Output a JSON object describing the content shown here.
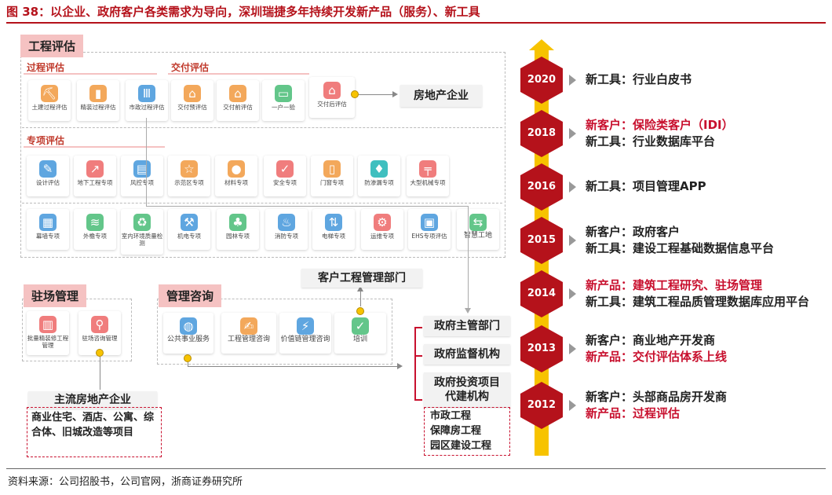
{
  "title": "图 38：以企业、政府客户各类需求为导向，深圳瑞捷多年持续开发新产品（服务）、新工具",
  "source": "资料来源：公司招股书，公司官网，浙商证券研究所",
  "engineering": {
    "header": "工程评估",
    "process_label": "过程评估",
    "delivery_label": "交付评估",
    "special_label": "专项评估",
    "process_items": [
      "土建过程评估",
      "精装过程评估",
      "市政过程评估"
    ],
    "delivery_items": [
      "交付预评估",
      "交付前评估",
      "一户一验",
      "交付后评估"
    ],
    "special_row1": [
      "设计评估",
      "地下工程专项",
      "风控专项",
      "示范区专项",
      "材料专项",
      "安全专项",
      "门窗专项",
      "防渗漏专项",
      "大型机械专项"
    ],
    "special_row2": [
      "幕墙专项",
      "外檐专项",
      "室内环境质量检测",
      "机电专项",
      "园林专项",
      "消防专项",
      "电梯专项",
      "运维专项",
      "EHS专项评估",
      "智慧工地"
    ],
    "target": "房地产企业"
  },
  "onsite": {
    "header": "驻场管理",
    "items": [
      "批量精装修工程管理",
      "驻场咨询管理"
    ],
    "target": "主流房地产企业",
    "target_desc": "商业住宅、酒店、公寓、综合体、旧城改造等项目"
  },
  "consulting": {
    "header": "管理咨询",
    "items": [
      "公共事业服务",
      "工程管理咨询",
      "价值链管理咨询",
      "培训"
    ],
    "client_box": "客户工程管理部门"
  },
  "government": {
    "boxes": [
      "政府主管部门",
      "政府监督机构",
      "政府投资项目代建机构"
    ],
    "projects": [
      "市政工程",
      "保障房工程",
      "园区建设工程"
    ]
  },
  "timeline": [
    {
      "year": "2020",
      "lines": [
        {
          "text": "新工具：行业白皮书",
          "red": false
        }
      ]
    },
    {
      "year": "2018",
      "lines": [
        {
          "text": "新客户：保险类客户（IDI）",
          "red": true
        },
        {
          "text": "新工具：行业数据库平台",
          "red": false
        }
      ]
    },
    {
      "year": "2016",
      "lines": [
        {
          "text": "新工具：项目管理APP",
          "red": false
        }
      ]
    },
    {
      "year": "2015",
      "lines": [
        {
          "text": "新客户：政府客户",
          "red": false
        },
        {
          "text": "新工具：建设工程基础数据信息平台",
          "red": false
        }
      ]
    },
    {
      "year": "2014",
      "lines": [
        {
          "text": "新产品：建筑工程研究、驻场管理",
          "red": true
        },
        {
          "text": "新工具：建筑工程品质管理数据库应用平台",
          "red": false
        }
      ]
    },
    {
      "year": "2013",
      "lines": [
        {
          "text": "新客户：商业地产开发商",
          "red": false
        },
        {
          "text": "新产品：交付评估体系上线",
          "red": true
        }
      ]
    },
    {
      "year": "2012",
      "lines": [
        {
          "text": "新客户：头部商品房开发商",
          "red": false
        },
        {
          "text": "新产品：过程评估",
          "red": true
        }
      ]
    }
  ]
}
